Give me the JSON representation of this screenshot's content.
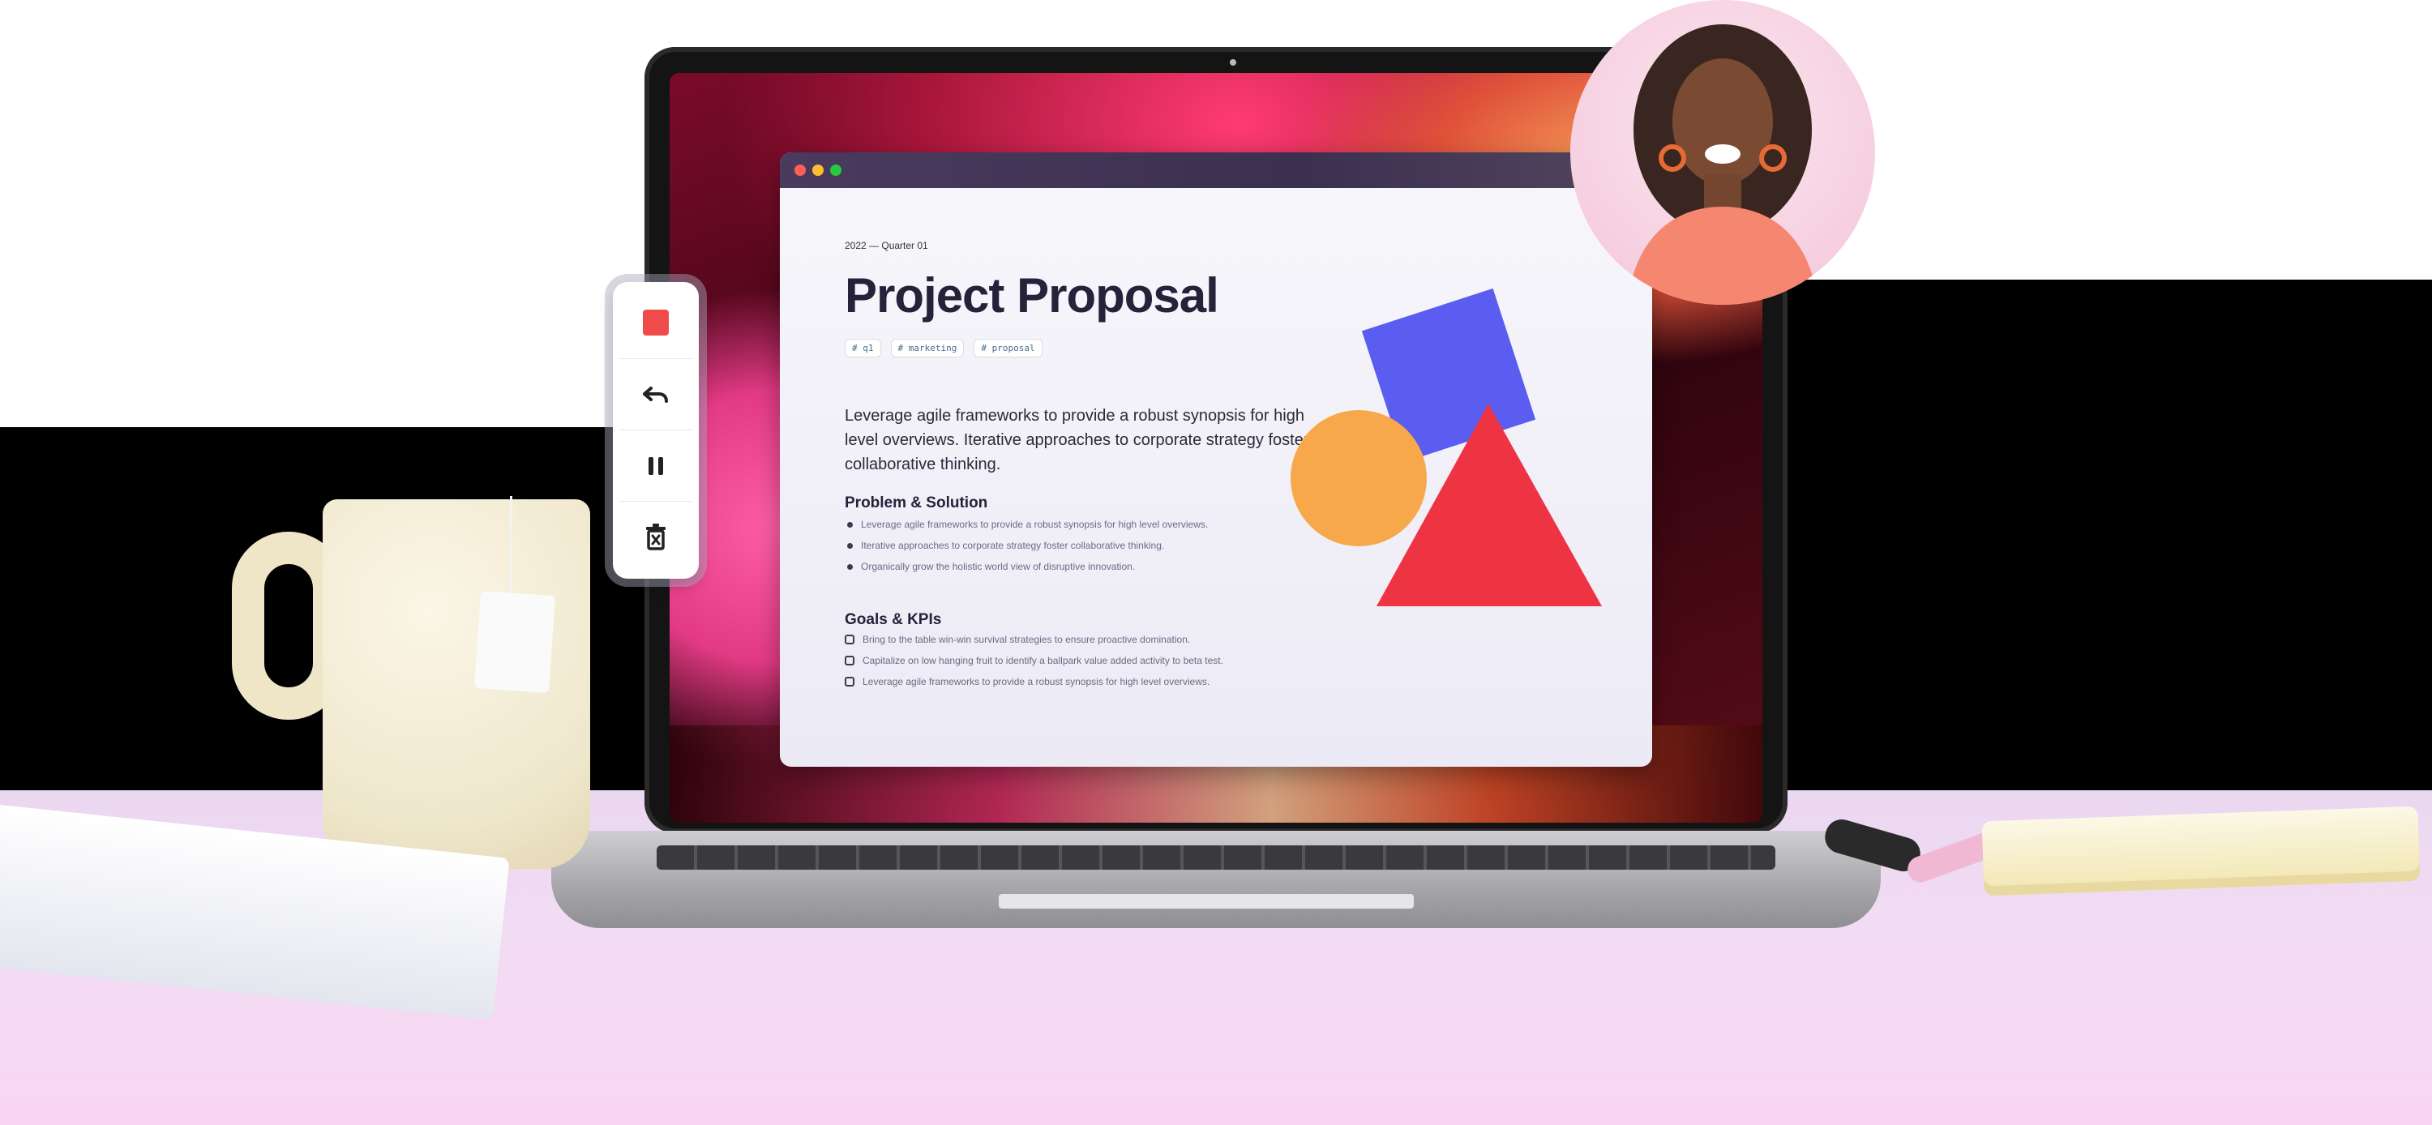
{
  "document": {
    "meta": "2022 — Quarter 01",
    "title": "Project Proposal",
    "tags": [
      "# q1",
      "# marketing",
      "# proposal"
    ],
    "intro": "Leverage agile frameworks to provide a robust synopsis for high level overviews. Iterative approaches to corporate strategy foster collaborative thinking.",
    "problem_heading": "Problem & Solution",
    "problem_items": [
      "Leverage agile frameworks to provide a robust synopsis for high level overviews.",
      "Iterative approaches to corporate strategy foster collaborative thinking.",
      "Organically grow the holistic world view of disruptive innovation."
    ],
    "goals_heading": "Goals & KPIs",
    "goals_items": [
      "Bring to the table win-win survival strategies to ensure proactive domination.",
      "Capitalize on low hanging fruit to identify a ballpark value added activity to beta test.",
      "Leverage agile frameworks to provide a robust synopsis for high level overviews."
    ]
  },
  "toolbar": {
    "buttons": [
      "stop-icon",
      "undo-icon",
      "pause-icon",
      "trash-icon"
    ]
  },
  "colors": {
    "stop": "#f04b4b",
    "square": "#5b5cf0",
    "circle": "#f7a84a",
    "triangle": "#ee3342",
    "window_titlebar": "#3b3050"
  }
}
